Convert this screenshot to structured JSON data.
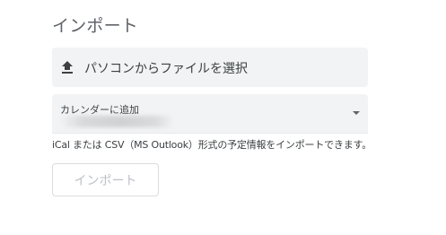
{
  "section": {
    "title": "インポート"
  },
  "file_select": {
    "icon": "upload-icon",
    "label": "パソコンからファイルを選択"
  },
  "calendar_select": {
    "label": "カレンダーに追加",
    "icon": "chevron-down-icon"
  },
  "help_text": "iCal または CSV（MS Outlook）形式の予定情報をインポートできます。",
  "import_button": {
    "label": "インポート",
    "enabled": false
  },
  "colors": {
    "field_background": "#f1f3f4",
    "text": "#3c4043",
    "title": "#5f6368",
    "disabled_text": "#bdc1c6",
    "button_border": "#dadce0"
  }
}
